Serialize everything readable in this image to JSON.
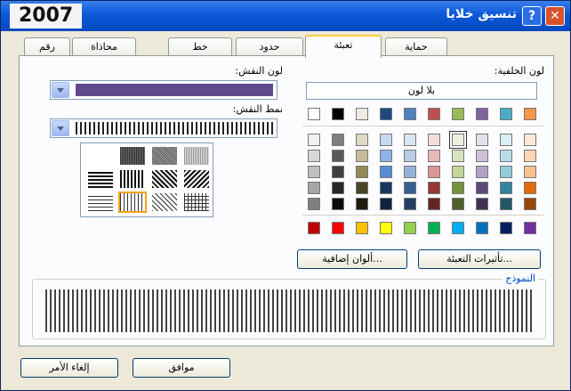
{
  "overlay_label": "2007",
  "window": {
    "title": "تنسيق خلايا",
    "help": "?",
    "close": "✕"
  },
  "tabs": [
    "رقم",
    "محاذاة",
    "خط",
    "حدود",
    "تعبئة",
    "حماية"
  ],
  "active_tab": "تعبئة",
  "fill": {
    "background_color_label": "لون الخلفية:",
    "no_color_label": "بلا لون",
    "pattern_color_label": "لون النقش:",
    "pattern_style_label": "نمط النقش:",
    "pattern_color_value": "#5f4b8b",
    "fill_effects_button": "تأثيرات التعبئة...",
    "more_colors_button": "ألوان إضافية...",
    "sample_label": "النموذج"
  },
  "palette": {
    "theme_top": [
      "#f79646",
      "#4bacc6",
      "#8064a2",
      "#9bbb59",
      "#c0504d",
      "#4f81bd",
      "#1f497d",
      "#eeece1",
      "#000000",
      "#ffffff"
    ],
    "shades": [
      [
        "#fde9d9",
        "#daeef3",
        "#e5e0ec",
        "#ebf1dd",
        "#f2dcdb",
        "#dbe5f1",
        "#c6d9f0",
        "#ddd9c3",
        "#7f7f7f",
        "#f2f2f2"
      ],
      [
        "#fbd5b5",
        "#b7dde8",
        "#ccc1d9",
        "#d7e3bc",
        "#e5b9b7",
        "#b8cce4",
        "#8db3e2",
        "#c4bd97",
        "#595959",
        "#d8d8d8"
      ],
      [
        "#fac08f",
        "#92cddc",
        "#b2a2c7",
        "#c3d69b",
        "#d99694",
        "#95b3d7",
        "#548dd4",
        "#938953",
        "#3f3f3f",
        "#bfbfbf"
      ],
      [
        "#e36c09",
        "#31859b",
        "#5f497a",
        "#76923c",
        "#953734",
        "#366092",
        "#17365d",
        "#494429",
        "#262626",
        "#a5a5a5"
      ],
      [
        "#974806",
        "#205867",
        "#3f3151",
        "#4f6128",
        "#632423",
        "#244061",
        "#0f243e",
        "#1d1b10",
        "#0c0c0c",
        "#7f7f7f"
      ]
    ],
    "standard": [
      "#7030a0",
      "#002060",
      "#0070c0",
      "#00b0f0",
      "#00b050",
      "#92d050",
      "#ffff00",
      "#ffc000",
      "#ff0000",
      "#c00000"
    ],
    "selected": "#ebf1dd"
  },
  "buttons": {
    "ok": "موافق",
    "cancel": "إلغاء الأمر"
  }
}
